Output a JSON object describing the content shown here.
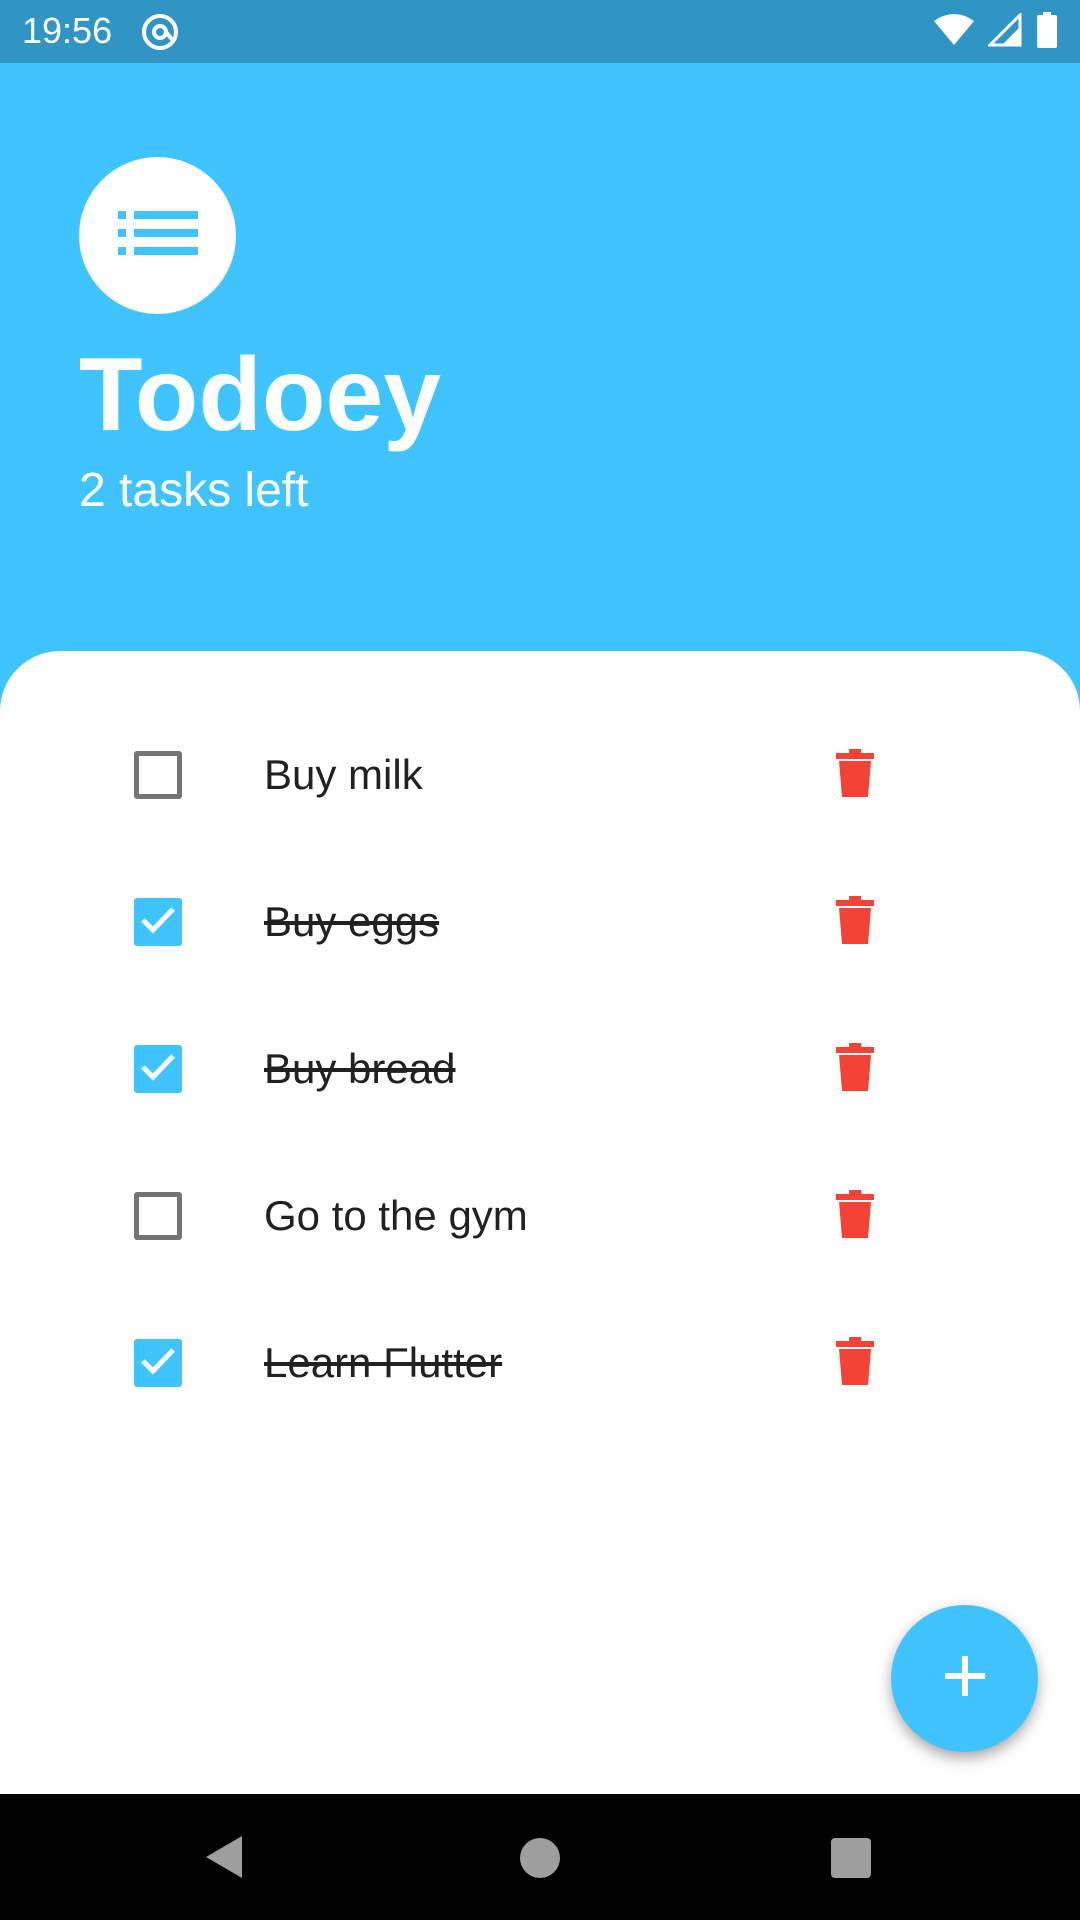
{
  "status_bar": {
    "time": "19:56",
    "app_icon": "at-sign-icon",
    "icons": [
      "wifi-icon",
      "signal-icon",
      "battery-icon"
    ]
  },
  "header": {
    "logo_icon": "list-icon",
    "title": "Todoey",
    "subtitle": "2 tasks left"
  },
  "tasks": [
    {
      "label": "Buy milk",
      "done": false
    },
    {
      "label": "Buy eggs",
      "done": true
    },
    {
      "label": "Buy bread",
      "done": true
    },
    {
      "label": "Go to the gym",
      "done": false
    },
    {
      "label": "Learn Flutter",
      "done": true
    }
  ],
  "fab": {
    "icon": "add-icon"
  },
  "nav_bar": {
    "icons": [
      "back-icon",
      "home-icon",
      "recents-icon"
    ]
  },
  "colors": {
    "accent": "#40c4ff",
    "status_bar": "#3095c4",
    "delete": "#f44336",
    "unchecked_border": "#757575"
  }
}
